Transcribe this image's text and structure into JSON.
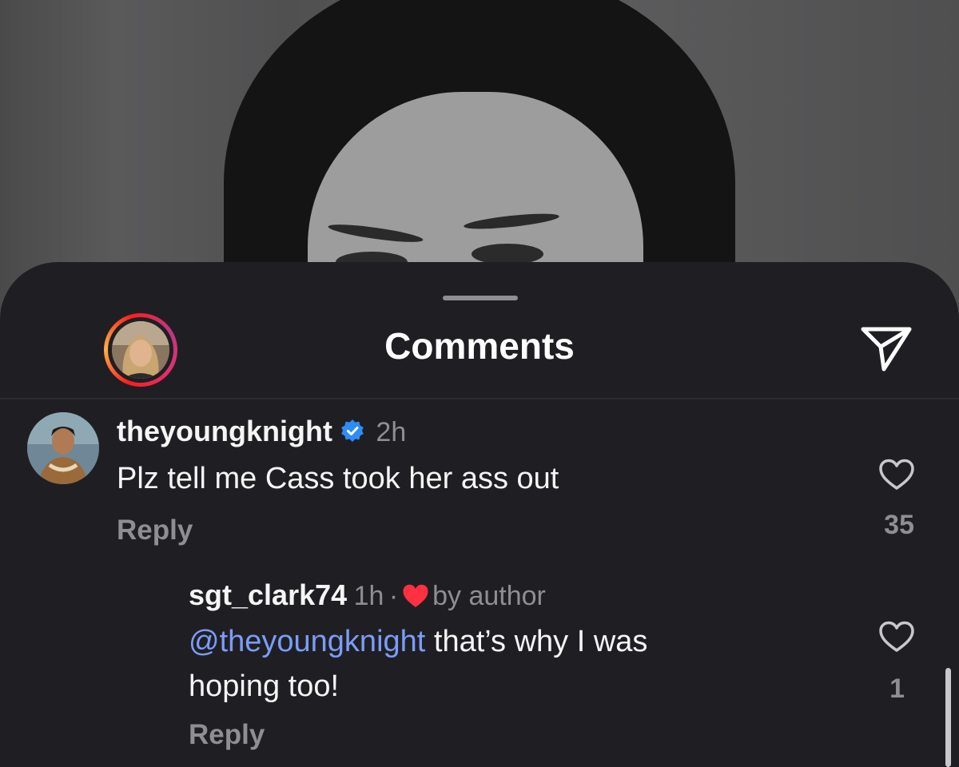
{
  "sheet": {
    "title": "Comments",
    "share_icon": "send-icon"
  },
  "comments": [
    {
      "username": "theyoungknight",
      "verified": true,
      "time": "2h",
      "text": "Plz tell me Cass took her ass out",
      "reply_label": "Reply",
      "like_count": "35"
    },
    {
      "username": "sgt_clark74",
      "time": "1h",
      "separator": "·",
      "liked_by_author": "by author",
      "mention": "@theyoungknight",
      "text_line1": " that’s why I was",
      "text_line2": "hoping too!",
      "reply_label": "Reply",
      "like_count": "1"
    }
  ],
  "colors": {
    "sheet_bg": "#1f1f23",
    "mention": "#7c9cf7",
    "verified": "#2f8cf5",
    "author_heart": "#ff3040"
  }
}
